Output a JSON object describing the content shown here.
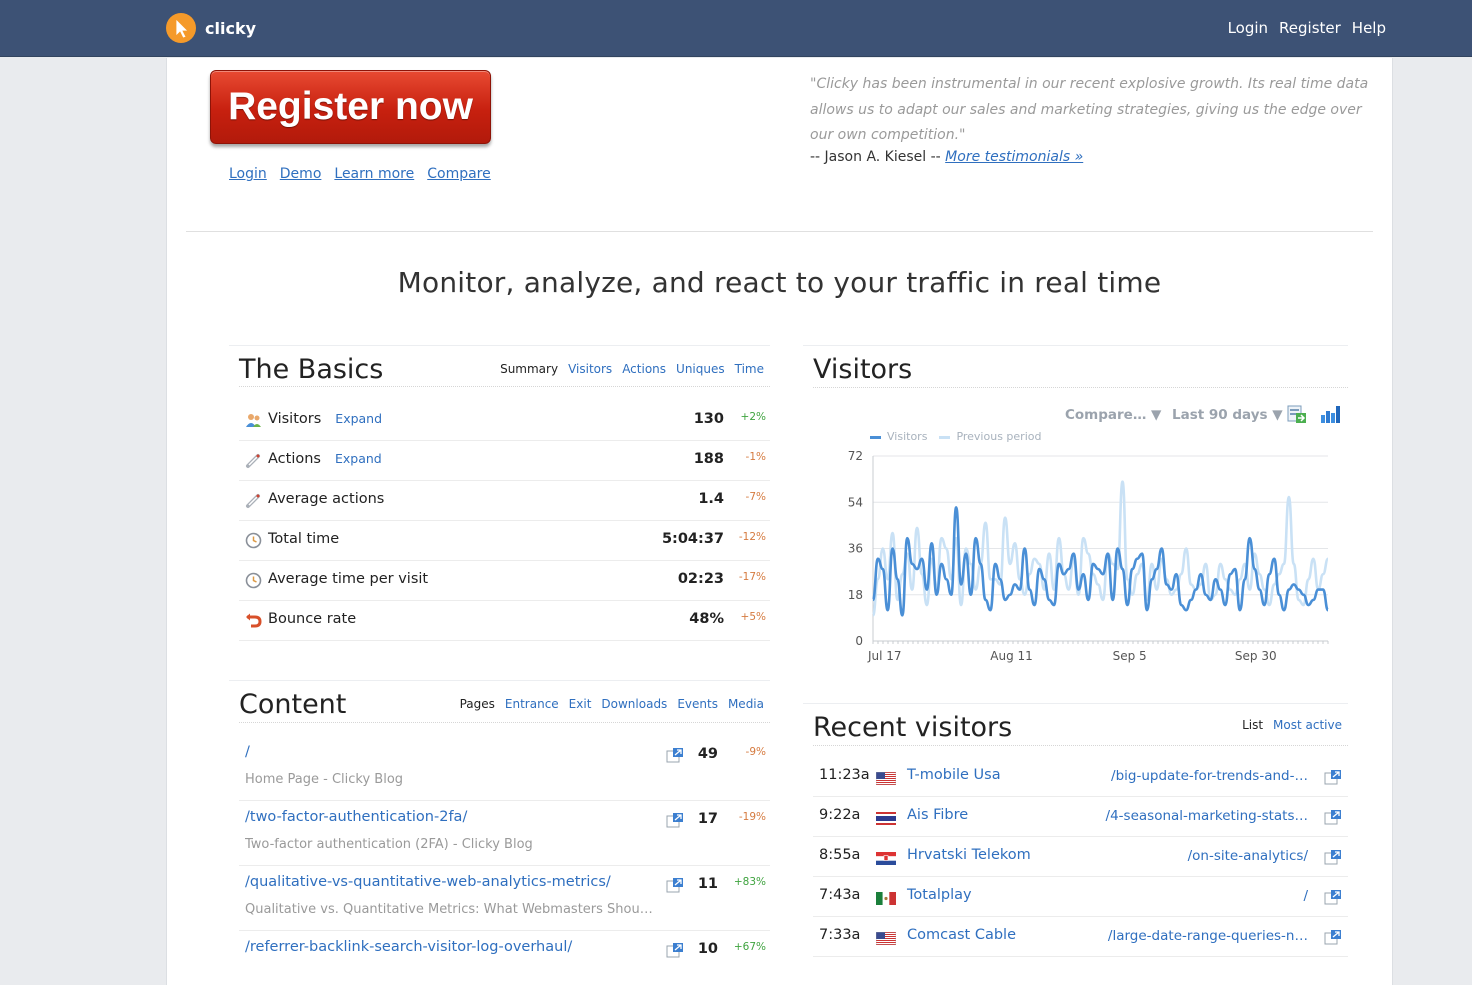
{
  "header": {
    "logo_text": "clicky",
    "nav": [
      "Login",
      "Register",
      "Help"
    ]
  },
  "hero": {
    "register_label": "Register now",
    "links": [
      "Login",
      "Demo",
      "Learn more",
      "Compare"
    ],
    "testimonial": "\"Clicky has been instrumental in our recent explosive growth. Its real time data allows us to adapt our sales and marketing strategies, giving us the edge over our own competition.\"",
    "author_prefix": "-- Jason A. Kiesel --",
    "more_link": "More testimonials »"
  },
  "headline": "Monitor, analyze, and react to your traffic in real time",
  "basics": {
    "title": "The Basics",
    "tabs": [
      "Summary",
      "Visitors",
      "Actions",
      "Uniques",
      "Time"
    ],
    "expand_label": "Expand",
    "rows": [
      {
        "icon": "visitors-icon",
        "label": "Visitors",
        "expand": true,
        "value": "130",
        "change": "+2%",
        "trend": "pos"
      },
      {
        "icon": "actions-icon",
        "label": "Actions",
        "expand": true,
        "value": "188",
        "change": "-1%",
        "trend": "neg"
      },
      {
        "icon": "average-actions-icon",
        "label": "Average actions",
        "expand": false,
        "value": "1.4",
        "change": "-7%",
        "trend": "neg"
      },
      {
        "icon": "clock-icon",
        "label": "Total time",
        "expand": false,
        "value": "5:04:37",
        "change": "-12%",
        "trend": "neg"
      },
      {
        "icon": "clock-icon",
        "label": "Average time per visit",
        "expand": false,
        "value": "02:23",
        "change": "-17%",
        "trend": "neg"
      },
      {
        "icon": "bounce-icon",
        "label": "Bounce rate",
        "expand": false,
        "value": "48%",
        "change": "+5%",
        "trend": "neg"
      }
    ]
  },
  "content": {
    "title": "Content",
    "tabs": [
      "Pages",
      "Entrance",
      "Exit",
      "Downloads",
      "Events",
      "Media"
    ],
    "rows": [
      {
        "path": "/",
        "title": "Home Page - Clicky Blog",
        "value": "49",
        "change": "-9%",
        "trend": "neg"
      },
      {
        "path": "/two-factor-authentication-2fa/",
        "title": "Two-factor authentication (2FA) - Clicky Blog",
        "value": "17",
        "change": "-19%",
        "trend": "neg"
      },
      {
        "path": "/qualitative-vs-quantitative-web-analytics-metrics/",
        "title": "Qualitative vs. Quantitative Metrics: What Webmasters Should…",
        "value": "11",
        "change": "+83%",
        "trend": "pos"
      },
      {
        "path": "/referrer-backlink-search-visitor-log-overhaul/",
        "title": "",
        "value": "10",
        "change": "+67%",
        "trend": "pos"
      }
    ]
  },
  "visitors": {
    "title": "Visitors",
    "compare_label": "Compare… ▼",
    "range_label": "Last 90 days ▼",
    "icons": [
      "export-icon",
      "bar-chart-icon"
    ]
  },
  "chart_data": {
    "type": "line",
    "x_tick_labels": [
      "Jul 17",
      "Aug 11",
      "Sep 5",
      "Sep 30"
    ],
    "ylim": [
      0,
      72
    ],
    "y_ticks": [
      0,
      18,
      36,
      54,
      72
    ],
    "legend_position": "top-left",
    "grid": true,
    "colors": {
      "current": "#4a8fd6",
      "previous": "#c9e1f5"
    },
    "series": [
      {
        "name": "Visitors",
        "values": [
          16,
          32,
          28,
          12,
          36,
          24,
          10,
          40,
          30,
          28,
          32,
          20,
          38,
          18,
          30,
          24,
          18,
          52,
          22,
          34,
          18,
          40,
          30,
          16,
          12,
          30,
          24,
          16,
          18,
          22,
          20,
          36,
          20,
          14,
          28,
          24,
          16,
          14,
          30,
          26,
          28,
          34,
          20,
          26,
          16,
          30,
          28,
          26,
          34,
          16,
          36,
          28,
          14,
          28,
          32,
          34,
          12,
          24,
          28,
          36,
          22,
          20,
          26,
          14,
          12,
          16,
          20,
          26,
          18,
          16,
          24,
          20,
          14,
          26,
          28,
          12,
          24,
          40,
          28,
          20,
          14,
          26,
          32,
          18,
          12,
          20,
          22,
          20,
          18,
          14,
          16,
          20,
          20,
          12
        ]
      },
      {
        "name": "Previous period",
        "values": [
          10,
          24,
          36,
          24,
          42,
          16,
          26,
          34,
          20,
          44,
          26,
          14,
          32,
          20,
          40,
          36,
          24,
          40,
          14,
          36,
          30,
          20,
          30,
          46,
          24,
          24,
          22,
          48,
          30,
          38,
          24,
          18,
          26,
          32,
          30,
          20,
          34,
          20,
          40,
          26,
          20,
          32,
          18,
          40,
          34,
          26,
          22,
          16,
          34,
          30,
          28,
          62,
          24,
          18,
          26,
          30,
          16,
          30,
          20,
          32,
          24,
          18,
          20,
          26,
          36,
          22,
          20,
          22,
          30,
          16,
          18,
          30,
          24,
          20,
          18,
          24,
          30,
          20,
          34,
          26,
          20,
          14,
          22,
          26,
          30,
          56,
          30,
          16,
          14,
          24,
          32,
          20,
          26,
          32
        ]
      }
    ]
  },
  "recent": {
    "title": "Recent visitors",
    "tabs": [
      "List",
      "Most active"
    ],
    "rows": [
      {
        "time": "11:23a",
        "flag": "us",
        "org": "T-mobile Usa",
        "path": "/big-update-for-trends-and-…"
      },
      {
        "time": "9:22a",
        "flag": "th",
        "org": "Ais Fibre",
        "path": "/4-seasonal-marketing-stats…"
      },
      {
        "time": "8:55a",
        "flag": "hr",
        "org": "Hrvatski Telekom",
        "path": "/on-site-analytics/"
      },
      {
        "time": "7:43a",
        "flag": "mx",
        "org": "Totalplay",
        "path": "/"
      },
      {
        "time": "7:33a",
        "flag": "us",
        "org": "Comcast Cable",
        "path": "/large-date-range-queries-n…"
      }
    ]
  }
}
